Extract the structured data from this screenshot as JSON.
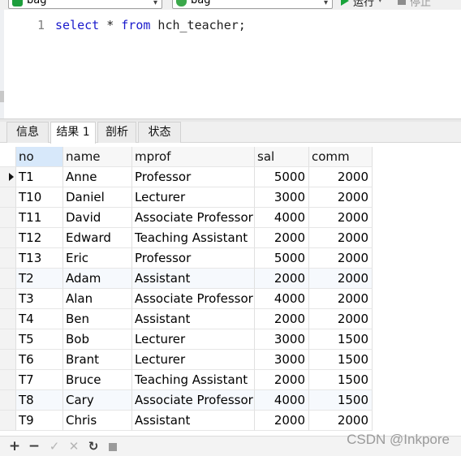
{
  "toolbar": {
    "database_label": "bag",
    "schema_label": "bag",
    "run_label": "运行",
    "stop_label": "停止"
  },
  "editor": {
    "line_number": "1",
    "sql_tokens": [
      {
        "text": "select",
        "kw": true
      },
      {
        "text": " * ",
        "kw": false
      },
      {
        "text": "from",
        "kw": true
      },
      {
        "text": " hch_teacher;",
        "kw": false
      }
    ]
  },
  "tabs": [
    {
      "label": "信息",
      "active": false
    },
    {
      "label": "结果 1",
      "active": true
    },
    {
      "label": "剖析",
      "active": false
    },
    {
      "label": "状态",
      "active": false
    }
  ],
  "result": {
    "columns": [
      "no",
      "name",
      "mprof",
      "sal",
      "comm"
    ],
    "numeric_columns": [
      "sal",
      "comm"
    ],
    "current_row": 0,
    "rows": [
      [
        "T1",
        "Anne",
        "Professor",
        "5000",
        "2000"
      ],
      [
        "T10",
        "Daniel",
        "Lecturer",
        "3000",
        "2000"
      ],
      [
        "T11",
        "David",
        "Associate Professor",
        "4000",
        "2000"
      ],
      [
        "T12",
        "Edward",
        "Teaching Assistant",
        "2000",
        "2000"
      ],
      [
        "T13",
        "Eric",
        "Professor",
        "5000",
        "2000"
      ],
      [
        "T2",
        "Adam",
        "Assistant",
        "2000",
        "2000"
      ],
      [
        "T3",
        "Alan",
        "Associate Professor",
        "4000",
        "2000"
      ],
      [
        "T4",
        "Ben",
        "Assistant",
        "2000",
        "2000"
      ],
      [
        "T5",
        "Bob",
        "Lecturer",
        "3000",
        "1500"
      ],
      [
        "T6",
        "Brant",
        "Lecturer",
        "3000",
        "1500"
      ],
      [
        "T7",
        "Bruce",
        "Teaching Assistant",
        "2000",
        "1500"
      ],
      [
        "T8",
        "Cary",
        "Associate Professor",
        "4000",
        "1500"
      ],
      [
        "T9",
        "Chris",
        "Assistant",
        "2000",
        "2000"
      ]
    ]
  },
  "bottom_toolbar": {
    "icons": [
      "plus-icon",
      "minus-icon",
      "check-icon",
      "cross-icon",
      "refresh-icon",
      "stop-icon"
    ],
    "glyphs": [
      "+",
      "−",
      "✓",
      "✕",
      "↻"
    ]
  },
  "watermark": "CSDN @Inkpore",
  "colors": {
    "keyword": "#1a1acc",
    "run_green": "#18a33a",
    "db_icon": "#1d9e3c",
    "schema_icon": "#3aa84a"
  }
}
